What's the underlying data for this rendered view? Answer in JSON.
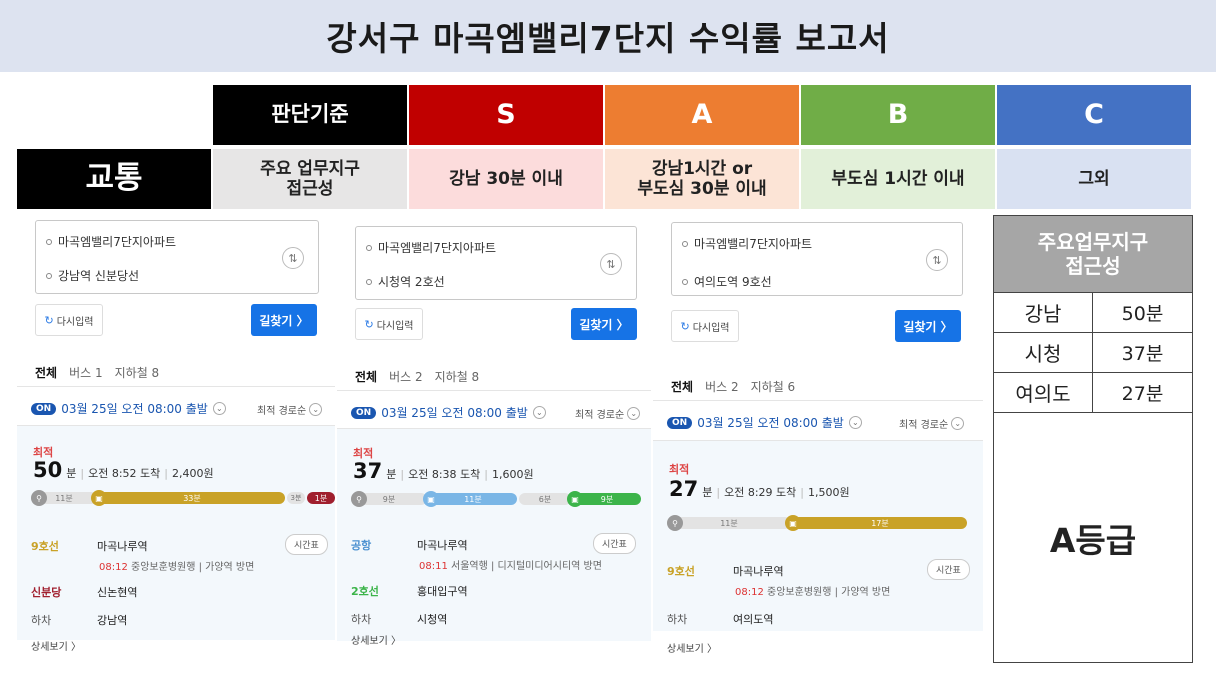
{
  "title": "강서구 마곡엠밸리7단지 수익률 보고서",
  "header": {
    "criteria_label": "판단기준",
    "grades": [
      "S",
      "A",
      "B",
      "C"
    ]
  },
  "colors": {
    "title_bg": "#dde3f0",
    "S": "#c00000",
    "A": "#ed7d31",
    "B": "#70ad47",
    "C": "#4472c4",
    "S_light": "#fcdcdc",
    "A_light": "#fce4d6",
    "B_light": "#e2f0d9",
    "C_light": "#d9e1f2"
  },
  "category": {
    "name": "교통",
    "criteria": "주요 업무지구\n접근성",
    "S": "강남 30분 이내",
    "A": "강남1시간 or\n부도심 30분 이내",
    "B": "부도심 1시간 이내",
    "C": "그외"
  },
  "routes": [
    {
      "from": "마곡엠밸리7단지아파트",
      "to": "강남역 신분당선",
      "reset_label": "다시입력",
      "go_label": "길찾기 〉",
      "tab_all": "전체",
      "tab_bus": "버스 1",
      "tab_subway": "지하철 8",
      "depart": "03월 25일 오전 08:00 출발",
      "sort": "최적 경로순",
      "best": "최적",
      "minutes": "50",
      "unit": "분",
      "arrive": "오전 8:52 도착",
      "fare": "2,400원",
      "segments": [
        "11분",
        "33분",
        "3분",
        "1분"
      ],
      "steps": [
        {
          "line": "9호선",
          "station": "마곡나루역",
          "detail_time": "08:12",
          "detail": "중앙보훈병원행 | 가양역 방면"
        },
        {
          "line": "신분당",
          "station": "신논현역"
        },
        {
          "line": "하차",
          "station": "강남역"
        }
      ],
      "timetable": "시간표",
      "more": "상세보기 〉"
    },
    {
      "from": "마곡엠밸리7단지아파트",
      "to": "시청역 2호선",
      "reset_label": "다시입력",
      "go_label": "길찾기 〉",
      "tab_all": "전체",
      "tab_bus": "버스 2",
      "tab_subway": "지하철 8",
      "depart": "03월 25일 오전 08:00 출발",
      "sort": "최적 경로순",
      "best": "최적",
      "minutes": "37",
      "unit": "분",
      "arrive": "오전 8:38 도착",
      "fare": "1,600원",
      "segments": [
        "9분",
        "11분",
        "6분",
        "9분"
      ],
      "steps": [
        {
          "line": "공항",
          "station": "마곡나루역",
          "detail_time": "08:11",
          "detail": "서울역행 | 디지털미디어시티역 방면"
        },
        {
          "line": "2호선",
          "station": "홍대입구역"
        },
        {
          "line": "하차",
          "station": "시청역"
        }
      ],
      "timetable": "시간표",
      "more": "상세보기 〉"
    },
    {
      "from": "마곡엠밸리7단지아파트",
      "to": "여의도역 9호선",
      "reset_label": "다시입력",
      "go_label": "길찾기 〉",
      "tab_all": "전체",
      "tab_bus": "버스 2",
      "tab_subway": "지하철 6",
      "depart": "03월 25일 오전 08:00 출발",
      "sort": "최적 경로순",
      "best": "최적",
      "minutes": "27",
      "unit": "분",
      "arrive": "오전 8:29 도착",
      "fare": "1,500원",
      "segments": [
        "11분",
        "17분"
      ],
      "steps": [
        {
          "line": "9호선",
          "station": "마곡나루역",
          "detail_time": "08:12",
          "detail": "중앙보훈병원행 | 가양역 방면"
        },
        {
          "line": "하차",
          "station": "여의도역"
        }
      ],
      "timetable": "시간표",
      "more": "상세보기 〉"
    }
  ],
  "summary": {
    "header": "주요업무지구\n접근성",
    "rows": [
      {
        "place": "강남",
        "time": "50분"
      },
      {
        "place": "시청",
        "time": "37분"
      },
      {
        "place": "여의도",
        "time": "27분"
      }
    ],
    "grade": "A등급"
  }
}
